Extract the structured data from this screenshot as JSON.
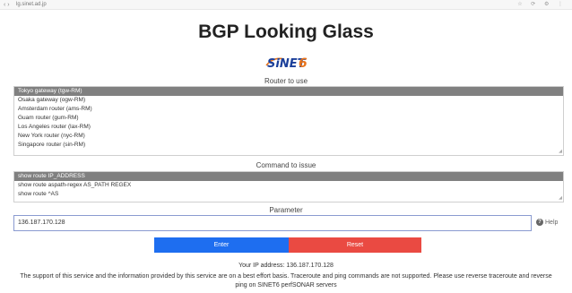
{
  "browser": {
    "nav": "‹ ›",
    "url": "lg.sinet.ad.jp",
    "tools": "☆ ⟳ ⚙ ⋮"
  },
  "page": {
    "title": "BGP Looking Glass",
    "logo_text": "SiNET",
    "logo_number": "6"
  },
  "router": {
    "label": "Router to use",
    "options": [
      "Tokyo gateway (tgw-RM)",
      "Osaka gateway (ogw-RM)",
      "Amsterdam router (ams-RM)",
      "Guam router (gum-RM)",
      "Los Angeles router (lax-RM)",
      "New York router (nyc-RM)",
      "Singapore router (sin-RM)"
    ],
    "selected_index": 0
  },
  "command": {
    "label": "Command to issue",
    "options": [
      "show route IP_ADDRESS",
      "show route aspath-regex AS_PATH REGEX",
      "show route ^AS"
    ],
    "selected_index": 0
  },
  "parameter": {
    "label": "Parameter",
    "value": "136.187.170.128",
    "help_label": "Help"
  },
  "buttons": {
    "enter_label": "Enter",
    "reset_label": "Reset"
  },
  "footer": {
    "ip_text": "Your IP address: 136.187.170.128",
    "disclaimer": "The support of this service and the information provided by this service are on a best effort basis. Traceroute and ping commands are not supported. Please use reverse traceroute and reverse ping on SINET6 perfSONAR servers"
  },
  "colors": {
    "enter": "#1e6ef0",
    "reset": "#ea4a42",
    "selected_option": "#808080",
    "logo_blue": "#1b3f9a",
    "logo_orange": "#e8731a"
  }
}
